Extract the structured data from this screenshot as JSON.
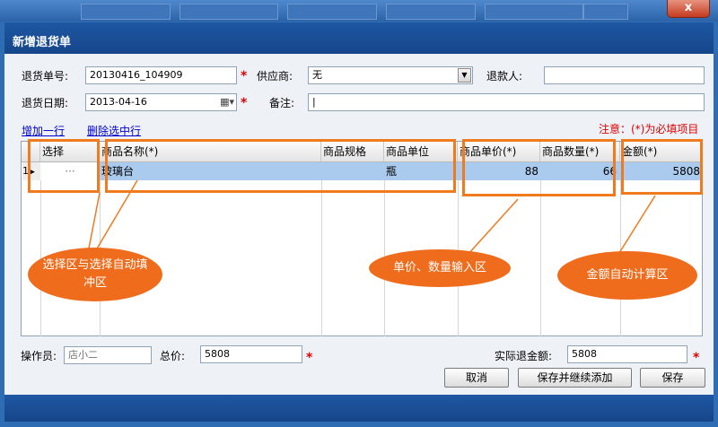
{
  "window": {
    "close_label": "x",
    "title": "新增退货单"
  },
  "form": {
    "return_no_label": "退货单号:",
    "return_no_value": "20130416_104909",
    "supplier_label": "供应商:",
    "supplier_value": "无",
    "refund_person_label": "退款人:",
    "refund_person_value": "",
    "return_date_label": "退货日期:",
    "return_date_value": "2013-04-16",
    "remark_label": "备注:",
    "remark_value": "|",
    "required_mark": "*"
  },
  "toolbar": {
    "add_row": "增加一行",
    "delete_row": "删除选中行",
    "note": "注意：(*)为必填项目"
  },
  "grid": {
    "columns": [
      "选择",
      "商品名称(*)",
      "商品规格",
      "商品单位",
      "商品单价(*)",
      "商品数量(*)",
      "金额(*)"
    ],
    "rows": [
      {
        "indicator": "1",
        "select": "···",
        "name": "玻璃台",
        "spec": "",
        "unit": "瓶",
        "price": "88",
        "qty": "66",
        "amount": "5808"
      }
    ]
  },
  "annotations": {
    "select_area": "选择区与选择自动填冲区",
    "input_area": "单价、数量输入区",
    "calc_area": "金额自动计算区"
  },
  "footer": {
    "operator_label": "操作员:",
    "operator_placeholder": "店小二",
    "total_label": "总价:",
    "total_value": "5808",
    "actual_refund_label": "实际退金额:",
    "actual_refund_value": "5808",
    "cancel": "取消",
    "save_continue": "保存并继续添加",
    "save": "保存"
  },
  "colors": {
    "title_bg": "#1b4f96",
    "annotation_orange": "#ef6c1c",
    "required_red": "#e00000",
    "link_blue": "#0000cc"
  }
}
